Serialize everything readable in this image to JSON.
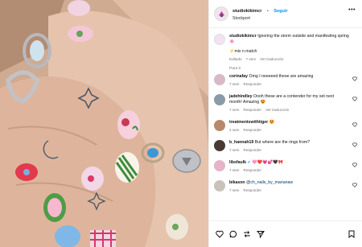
{
  "header": {
    "username": "studiokikimcr",
    "separator": "•",
    "follow_label": "Seguir",
    "location": "Stockport",
    "more_label": "•••"
  },
  "caption": {
    "username": "studiokikimcr",
    "text_line1": "Ignoring the storm outside and manifesting spring",
    "text_line2": "🌸",
    "text_line3": "⚡mix n match",
    "edited": "Editado",
    "age": "7 sem",
    "translation_label": "Ver traducción"
  },
  "translate_link": "Para ti",
  "comments": [
    {
      "username": "corinafay",
      "text": "Omg I neeeeed these are amazing",
      "age": "7 sem",
      "reply": "Responder",
      "avatar_color": "#d9b9c8"
    },
    {
      "username": "jadehindley",
      "text": "Oooh these are a contender for my set next month! Amazing 😍",
      "age": "7 sem",
      "reply": "Responder",
      "translation_label": "Ver traducción",
      "avatar_color": "#8a9aa8"
    },
    {
      "username": "treatmentswithtiger",
      "text": "😍",
      "age": "2 sem",
      "reply": "Responder",
      "avatar_color": "#b98a6a"
    },
    {
      "username": "b_hannah19",
      "text": "But where are the rings from?",
      "age": "7 sem",
      "reply": "Responder",
      "avatar_color": "#4a3a34"
    },
    {
      "username": "libsfaulk",
      "text": "🩷❤️💗💕🖤🎀",
      "verified": "✔",
      "age": "7 sem",
      "reply": "Responder",
      "avatar_color": "#e6b3c8"
    },
    {
      "username": "bikason",
      "text": "@ch_nails_by_marianaw",
      "age": "7 sem",
      "reply": "Responder",
      "avatar_color": "#c9c2bb"
    }
  ],
  "actions": {
    "like_icon": "heart-icon",
    "comment_icon": "comment-icon",
    "share_icon": "share-icon",
    "save_icon": "bookmark-icon"
  },
  "colors": {
    "link_blue": "#0095f6",
    "muted": "#737373",
    "mention": "#00376b"
  }
}
